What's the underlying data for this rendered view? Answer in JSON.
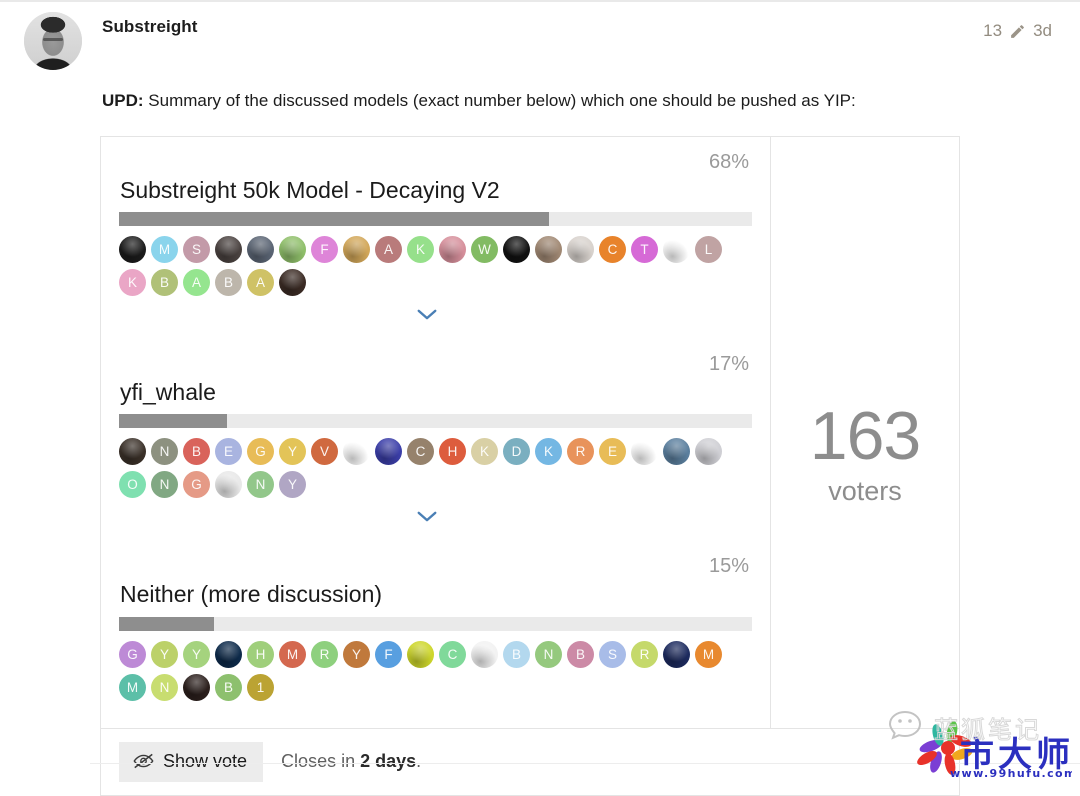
{
  "post": {
    "author": "Substreight",
    "edit_count": "13",
    "edit_icon": "pencil-icon",
    "time_ago": "3d",
    "body_lead": "UPD:",
    "body_text": " Summary of the discussed models (exact number below) which one should be pushed as YIP:"
  },
  "poll": {
    "voters_count": "163",
    "voters_label": "voters",
    "show_vote_label": "Show vote",
    "show_vote_icon": "eye-off-icon",
    "closes_prefix": "Closes in ",
    "closes_value": "2 days",
    "closes_suffix": ".",
    "expand_icon": "chevron-down-icon",
    "bar_fill_color": "#8e8e8e",
    "bar_track_color": "#eaeaea",
    "options": [
      {
        "percent": "68%",
        "percent_value": 68,
        "title": "Substreight 50k Model - Decaying V2",
        "has_expand": true,
        "voters": [
          {
            "letter": "",
            "color": "#1b1b1b",
            "photo": true
          },
          {
            "letter": "M",
            "color": "#8ad4ec",
            "photo": false
          },
          {
            "letter": "S",
            "color": "#c39aa8",
            "photo": false
          },
          {
            "letter": "",
            "color": "#4a4240",
            "photo": true
          },
          {
            "letter": "",
            "color": "#5a6473",
            "photo": true
          },
          {
            "letter": "",
            "color": "#8fbf6a",
            "photo": true
          },
          {
            "letter": "F",
            "color": "#de85d8",
            "photo": false
          },
          {
            "letter": "",
            "color": "#d2a759",
            "photo": true
          },
          {
            "letter": "A",
            "color": "#b97b7b",
            "photo": false
          },
          {
            "letter": "K",
            "color": "#96e08b",
            "photo": false
          },
          {
            "letter": "",
            "color": "#d68f9b",
            "photo": true
          },
          {
            "letter": "W",
            "color": "#82bb63",
            "photo": false
          },
          {
            "letter": "",
            "color": "#111111",
            "photo": true
          },
          {
            "letter": "",
            "color": "#a08873",
            "photo": true
          },
          {
            "letter": "",
            "color": "#d8d2cd",
            "photo": true
          },
          {
            "letter": "C",
            "color": "#e8832b",
            "photo": false
          },
          {
            "letter": "T",
            "color": "#d66ad6",
            "photo": false
          },
          {
            "letter": "",
            "color": "#ffffff",
            "photo": true
          },
          {
            "letter": "L",
            "color": "#c0a3a3",
            "photo": false
          },
          {
            "letter": "K",
            "color": "#eaa6c6",
            "photo": false
          },
          {
            "letter": "B",
            "color": "#b0c178",
            "photo": false
          },
          {
            "letter": "A",
            "color": "#95e58f",
            "photo": false
          },
          {
            "letter": "B",
            "color": "#bdb6ab",
            "photo": false
          },
          {
            "letter": "A",
            "color": "#cfc266",
            "photo": false
          },
          {
            "letter": "",
            "color": "#3b2b24",
            "photo": true
          }
        ]
      },
      {
        "percent": "17%",
        "percent_value": 17,
        "title": "yfi_whale",
        "has_expand": true,
        "voters": [
          {
            "letter": "",
            "color": "#3a3028",
            "photo": true
          },
          {
            "letter": "N",
            "color": "#8d9180",
            "photo": false
          },
          {
            "letter": "B",
            "color": "#d9635b",
            "photo": false
          },
          {
            "letter": "E",
            "color": "#a9b4e0",
            "photo": false
          },
          {
            "letter": "G",
            "color": "#e8bc57",
            "photo": false
          },
          {
            "letter": "Y",
            "color": "#e3c458",
            "photo": false
          },
          {
            "letter": "V",
            "color": "#d0693f",
            "photo": false
          },
          {
            "letter": "",
            "color": "#ffffff",
            "photo": true
          },
          {
            "letter": "",
            "color": "#3b3ea8",
            "photo": true
          },
          {
            "letter": "C",
            "color": "#96826c",
            "photo": false
          },
          {
            "letter": "H",
            "color": "#dd5c3d",
            "photo": false
          },
          {
            "letter": "K",
            "color": "#d9d0a5",
            "photo": false
          },
          {
            "letter": "D",
            "color": "#7aafc0",
            "photo": false
          },
          {
            "letter": "K",
            "color": "#74b7e3",
            "photo": false
          },
          {
            "letter": "R",
            "color": "#e8935b",
            "photo": false
          },
          {
            "letter": "E",
            "color": "#e8bc57",
            "photo": false
          },
          {
            "letter": "",
            "color": "#ffffff",
            "photo": true
          },
          {
            "letter": "",
            "color": "#5b7f9e",
            "photo": true
          },
          {
            "letter": "",
            "color": "#cfcfd4",
            "photo": true
          },
          {
            "letter": "O",
            "color": "#7fe0b0",
            "photo": false
          },
          {
            "letter": "N",
            "color": "#81a883",
            "photo": false
          },
          {
            "letter": "G",
            "color": "#e59a86",
            "photo": false
          },
          {
            "letter": "",
            "color": "#e8e8e8",
            "photo": true
          },
          {
            "letter": "N",
            "color": "#92c78a",
            "photo": false
          },
          {
            "letter": "Y",
            "color": "#b0a6c4",
            "photo": false
          }
        ]
      },
      {
        "percent": "15%",
        "percent_value": 15,
        "title": "Neither (more discussion)",
        "has_expand": false,
        "voters": [
          {
            "letter": "G",
            "color": "#bd8ad6",
            "photo": false
          },
          {
            "letter": "Y",
            "color": "#bcd169",
            "photo": false
          },
          {
            "letter": "Y",
            "color": "#a5d37e",
            "photo": false
          },
          {
            "letter": "",
            "color": "#0d2a4a",
            "photo": true
          },
          {
            "letter": "H",
            "color": "#9fcf7b",
            "photo": false
          },
          {
            "letter": "M",
            "color": "#d4684f",
            "photo": false
          },
          {
            "letter": "R",
            "color": "#8ed07e",
            "photo": false
          },
          {
            "letter": "Y",
            "color": "#c0793c",
            "photo": false
          },
          {
            "letter": "F",
            "color": "#589fe0",
            "photo": false
          },
          {
            "letter": "",
            "color": "#cdd62b",
            "photo": true
          },
          {
            "letter": "C",
            "color": "#80d99a",
            "photo": false
          },
          {
            "letter": "",
            "color": "#f2f2f2",
            "photo": true
          },
          {
            "letter": "B",
            "color": "#b3d8ee",
            "photo": false
          },
          {
            "letter": "N",
            "color": "#95c97e",
            "photo": false
          },
          {
            "letter": "B",
            "color": "#cc8aa6",
            "photo": false
          },
          {
            "letter": "S",
            "color": "#a8bce8",
            "photo": false
          },
          {
            "letter": "R",
            "color": "#c5d96b",
            "photo": false
          },
          {
            "letter": "",
            "color": "#1c2a5e",
            "photo": true
          },
          {
            "letter": "M",
            "color": "#e8892f",
            "photo": false
          },
          {
            "letter": "M",
            "color": "#5cbfa8",
            "photo": false
          },
          {
            "letter": "N",
            "color": "#c8dd70",
            "photo": false
          },
          {
            "letter": "",
            "color": "#2b1f1c",
            "photo": true
          },
          {
            "letter": "B",
            "color": "#8dc06e",
            "photo": false
          },
          {
            "letter": "1",
            "color": "#bba333",
            "photo": false
          }
        ]
      }
    ]
  },
  "watermark": {
    "site": "www.99hufu.com",
    "brand": "市大师",
    "subtitle": "蓝狐笔记"
  }
}
